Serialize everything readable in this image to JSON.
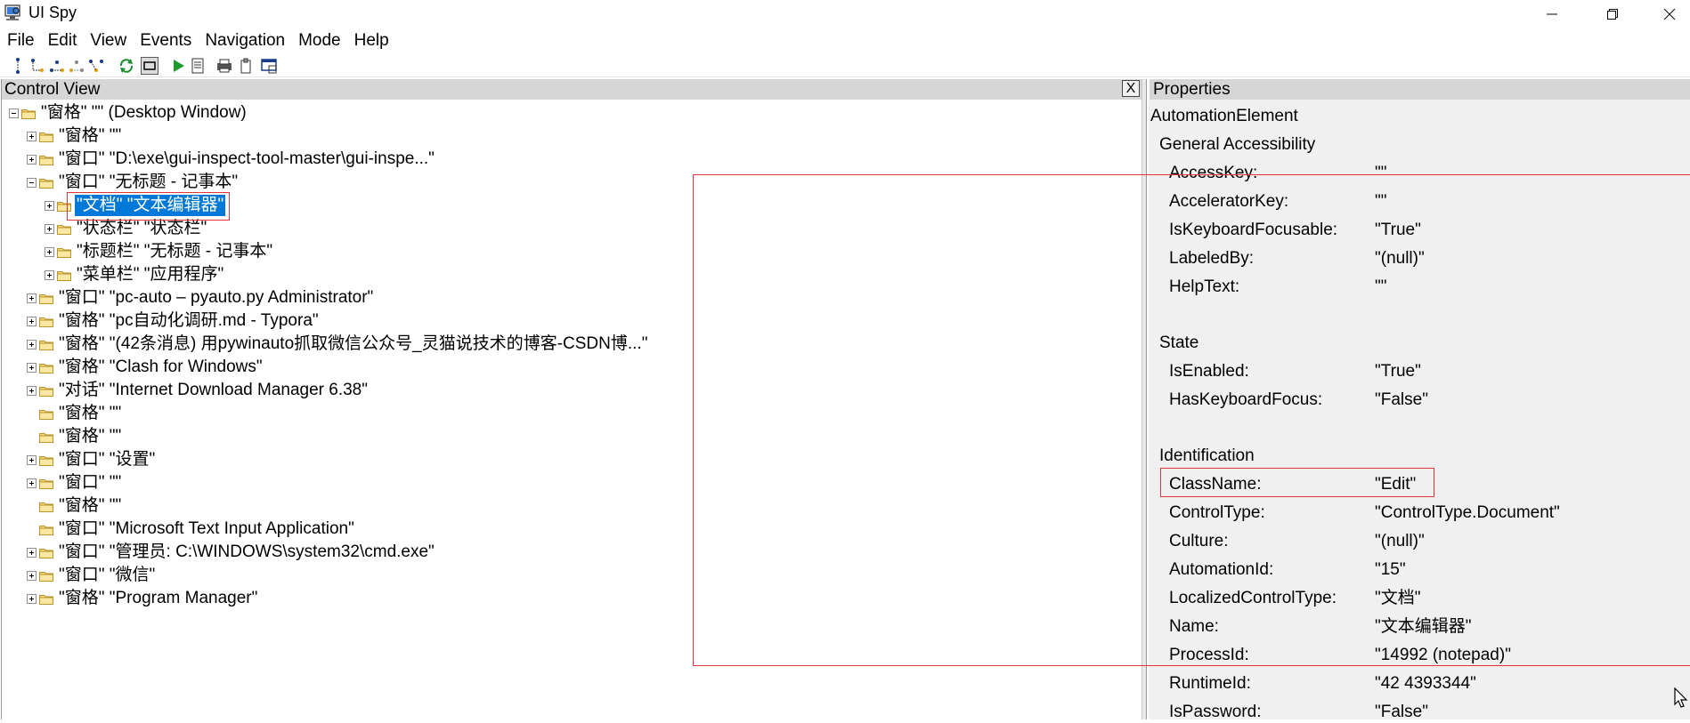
{
  "window": {
    "title": "UI Spy",
    "icon": "app-icon"
  },
  "menu": [
    "File",
    "Edit",
    "View",
    "Events",
    "Navigation",
    "Mode",
    "Help"
  ],
  "toolbar": {
    "icons": [
      "tree-parent-icon",
      "tree-first-child-icon",
      "tree-next-sibling-icon",
      "tree-prev-sibling-icon",
      "tree-last-child-icon",
      "refresh-icon",
      "highlight-icon",
      "run-icon",
      "report-icon",
      "print-icon",
      "clipboard-icon",
      "window-capture-icon"
    ]
  },
  "left_pane": {
    "title": "Control View",
    "close_label": "X",
    "tree": [
      {
        "text": "\"窗格\" \"\" (Desktop Window)",
        "expander": "minus"
      },
      {
        "text": "\"窗格\" \"\"",
        "expander": "plus"
      },
      {
        "text": "\"窗口\" \"D:\\exe\\gui-inspect-tool-master\\gui-inspe...\"",
        "expander": "plus"
      },
      {
        "text": "\"窗口\" \"无标题 - 记事本\"",
        "expander": "minus"
      },
      {
        "text": "\"文档\" \"文本编辑器\"",
        "expander": "plus",
        "selected": true
      },
      {
        "text": "\"状态栏\" \"状态栏\"",
        "expander": "plus"
      },
      {
        "text": "\"标题栏\" \"无标题 - 记事本\"",
        "expander": "plus"
      },
      {
        "text": "\"菜单栏\" \"应用程序\"",
        "expander": "plus"
      },
      {
        "text": "\"窗口\" \"pc-auto – pyauto.py Administrator\"",
        "expander": "plus"
      },
      {
        "text": "\"窗格\" \"pc自动化调研.md - Typora\"",
        "expander": "plus"
      },
      {
        "text": "\"窗格\" \"(42条消息) 用pywinauto抓取微信公众号_灵猫说技术的博客-CSDN博...\"",
        "expander": "plus"
      },
      {
        "text": "\"窗格\" \"Clash for Windows\"",
        "expander": "plus"
      },
      {
        "text": "\"对话\" \"Internet Download Manager 6.38\"",
        "expander": "plus"
      },
      {
        "text": "\"窗格\" \"\"",
        "expander": "none"
      },
      {
        "text": "\"窗格\" \"\"",
        "expander": "none"
      },
      {
        "text": "\"窗口\" \"设置\"",
        "expander": "plus"
      },
      {
        "text": "\"窗口\" \"\"",
        "expander": "plus"
      },
      {
        "text": "\"窗格\" \"\"",
        "expander": "none"
      },
      {
        "text": "\"窗口\" \"Microsoft Text Input Application\"",
        "expander": "none"
      },
      {
        "text": "\"窗口\" \"管理员: C:\\WINDOWS\\system32\\cmd.exe\"",
        "expander": "plus"
      },
      {
        "text": "\"窗口\" \"微信\"",
        "expander": "plus"
      },
      {
        "text": "\"窗格\" \"Program Manager\"",
        "expander": "plus"
      }
    ]
  },
  "right_pane": {
    "title": "Properties",
    "root": "AutomationElement",
    "sections": [
      {
        "title": "General Accessibility",
        "props": [
          {
            "name": "AccessKey:",
            "value": "\"\""
          },
          {
            "name": "AcceleratorKey:",
            "value": "\"\""
          },
          {
            "name": "IsKeyboardFocusable:",
            "value": "\"True\""
          },
          {
            "name": "LabeledBy:",
            "value": "\"(null)\""
          },
          {
            "name": "HelpText:",
            "value": "\"\""
          }
        ]
      },
      {
        "title": "State",
        "props": [
          {
            "name": "IsEnabled:",
            "value": "\"True\""
          },
          {
            "name": "HasKeyboardFocus:",
            "value": "\"False\""
          }
        ]
      },
      {
        "title": "Identification",
        "props": [
          {
            "name": "ClassName:",
            "value": "\"Edit\""
          },
          {
            "name": "ControlType:",
            "value": "\"ControlType.Document\""
          },
          {
            "name": "Culture:",
            "value": "\"(null)\""
          },
          {
            "name": "AutomationId:",
            "value": "\"15\""
          },
          {
            "name": "LocalizedControlType:",
            "value": "\"文档\""
          },
          {
            "name": "Name:",
            "value": "\"文本编辑器\""
          },
          {
            "name": "ProcessId:",
            "value": "\"14992 (notepad)\""
          },
          {
            "name": "RuntimeId:",
            "value": "\"42 4393344\""
          },
          {
            "name": "IsPassword:",
            "value": "\"False\""
          }
        ]
      }
    ]
  },
  "colors": {
    "selection": "#0078d7",
    "pane_header": "#d6d6d6",
    "properties_bg": "#f0f0f0",
    "annotation": "#e0343b"
  }
}
